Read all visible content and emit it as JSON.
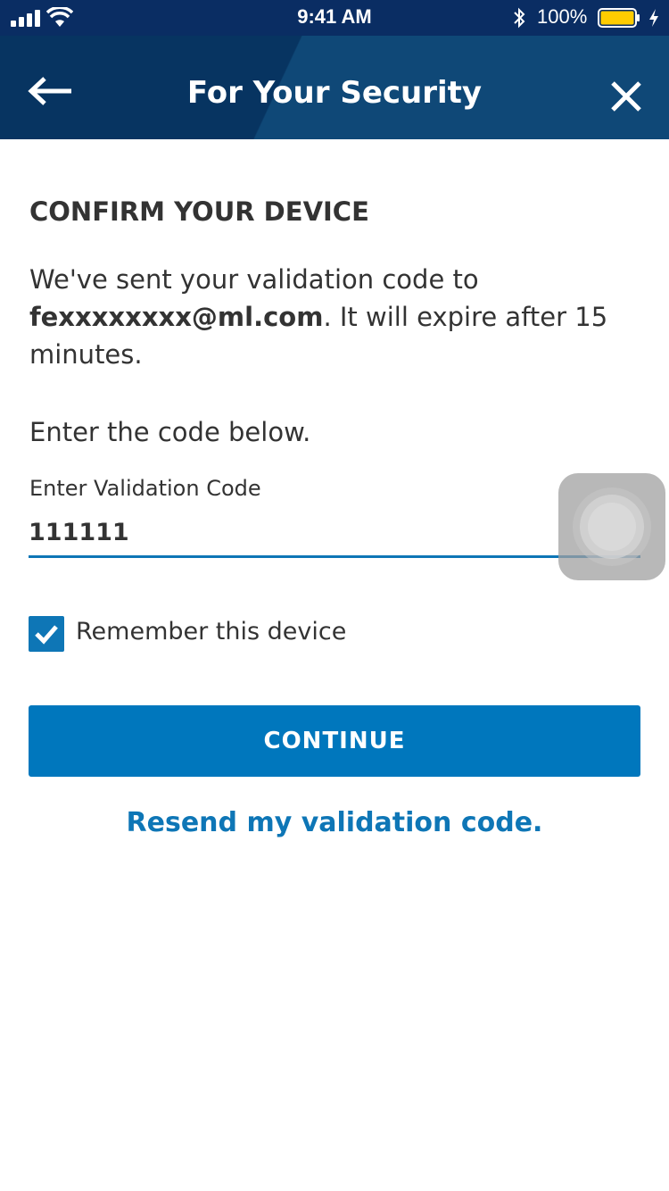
{
  "status_bar": {
    "time": "9:41 AM",
    "battery_percent": "100%",
    "battery_fill": 1.0,
    "battery_color": "#ffcc00",
    "icons": [
      "signal-icon",
      "wifi-icon",
      "bluetooth-icon",
      "battery-icon",
      "charging-icon"
    ]
  },
  "nav": {
    "title": "For Your Security",
    "back_icon": "back-arrow-icon",
    "close_icon": "close-icon"
  },
  "content": {
    "heading": "CONFIRM YOUR DEVICE",
    "intro_prefix": "We've sent your validation code to ",
    "intro_email": "fexxxxxxxx@ml.com",
    "intro_suffix": ". It will expire after 15 minutes.",
    "instruction": "Enter the code below."
  },
  "code_field": {
    "label": "Enter Validation Code",
    "value": "111111"
  },
  "remember_device": {
    "label": "Remember this device",
    "checked": true
  },
  "continue_button": {
    "label": "CONTINUE"
  },
  "resend_link": {
    "label": "Resend my validation code."
  },
  "colors": {
    "primary": "#0077bd",
    "nav_background": "#073461",
    "text": "#333333"
  }
}
